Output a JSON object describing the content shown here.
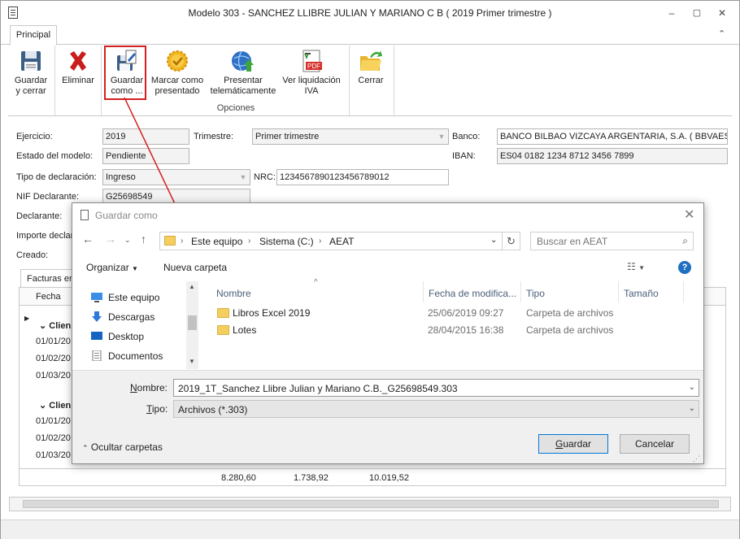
{
  "window": {
    "title": "Modelo 303 -  SANCHEZ LLIBRE JULIAN Y MARIANO C B ( 2019 Primer trimestre )",
    "controls": [
      "–",
      "▢",
      "✕"
    ]
  },
  "ribbon": {
    "tab": "Principal",
    "buttons": [
      {
        "label": "Guardar\ny cerrar",
        "icon": "floppy-disk-icon"
      },
      {
        "label": "Eliminar",
        "icon": "red-x-icon"
      },
      {
        "label": "Guardar\ncomo ...",
        "icon": "save-as-icon"
      },
      {
        "label": "Marcar como\npresentado",
        "icon": "gold-seal-icon"
      },
      {
        "label": "Presentar\ntelemáticamente",
        "icon": "globe-upload-icon"
      },
      {
        "label": "Ver liquidación\nIVA",
        "icon": "pdf-document-icon"
      },
      {
        "label": "Cerrar",
        "icon": "folder-exit-icon"
      }
    ],
    "group_label": "Opciones"
  },
  "form": {
    "ejercicio_label": "Ejercicio:",
    "ejercicio_value": "2019",
    "trimestre_label": "Trimestre:",
    "trimestre_value": "Primer trimestre",
    "banco_label": "Banco:",
    "banco_value": "BANCO BILBAO VIZCAYA ARGENTARIA, S.A. ( BBVAESMM",
    "estado_label": "Estado del modelo:",
    "estado_value": "Pendiente",
    "iban_label": "IBAN:",
    "iban_value": "ES04 0182 1234 8712 3456 7899",
    "tipo_label": "Tipo de declaración:",
    "tipo_value": "Ingreso",
    "nrc_label": "NRC:",
    "nrc_value": "1234567890123456789012",
    "nif_label": "NIF Declarante:",
    "nif_value": "G25698549",
    "declarante_label": "Declarante:",
    "importe_label": "Importe declar",
    "creado_label": "Creado:"
  },
  "grid": {
    "tab": "Facturas em",
    "col_fecha": "Fecha",
    "group1": "Clien",
    "group2": "Clien",
    "dates": [
      "01/01/20",
      "01/02/20",
      "01/03/20",
      "01/01/20",
      "01/02/20",
      "01/03/20"
    ],
    "totals": [
      "8.280,60",
      "1.738,92",
      "10.019,52"
    ]
  },
  "dialog": {
    "title": "Guardar como",
    "breadcrumb": [
      "Este equipo",
      "Sistema (C:)",
      "AEAT"
    ],
    "search_placeholder": "Buscar en AEAT",
    "organizar": "Organizar",
    "nueva_carpeta": "Nueva carpeta",
    "nav_items": [
      {
        "label": "Este equipo",
        "icon": "computer-icon"
      },
      {
        "label": "Descargas",
        "icon": "download-arrow-icon"
      },
      {
        "label": "Desktop",
        "icon": "desktop-icon"
      },
      {
        "label": "Documentos",
        "icon": "documents-icon"
      }
    ],
    "columns": [
      "Nombre",
      "Fecha de modifica...",
      "Tipo",
      "Tamaño"
    ],
    "files": [
      {
        "name": "Libros Excel 2019",
        "date": "25/06/2019 09:27",
        "type": "Carpeta de archivos"
      },
      {
        "name": "Lotes",
        "date": "28/04/2015 16:38",
        "type": "Carpeta de archivos"
      }
    ],
    "nombre_label_pre": "N",
    "nombre_label_post": "ombre:",
    "nombre_value": "2019_1T_Sanchez Llibre Julian y Mariano C.B._G25698549.303",
    "tipo_label_pre": "T",
    "tipo_label_post": "ipo:",
    "tipo_value": "Archivos  (*.303)",
    "ocultar": "Ocultar carpetas",
    "guardar_pre": "G",
    "guardar_post": "uardar",
    "cancelar": "Cancelar"
  },
  "colors": {
    "highlight": "#d42020",
    "accent": "#1f6fc0",
    "folder": "#f4cf60"
  }
}
